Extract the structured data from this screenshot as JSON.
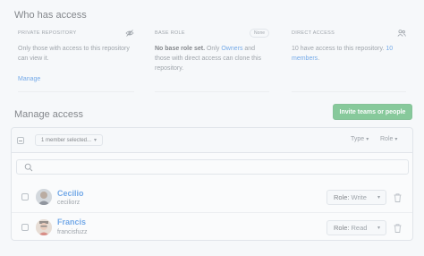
{
  "who_has_access": {
    "title": "Who has access",
    "private_repo": {
      "label": "PRIVATE REPOSITORY",
      "text": "Only those with access to this repository can view it.",
      "link": "Manage",
      "icon": "eye-closed-icon"
    },
    "base_role": {
      "label": "BASE ROLE",
      "badge": "None",
      "bold": "No base role set.",
      "text_1": " Only ",
      "link": "Owners",
      "text_2": " and those with direct access can clone this repository."
    },
    "direct_access": {
      "label": "DIRECT ACCESS",
      "icon": "people-icon",
      "text_1": "10 have access to this repository. ",
      "link": "10 members",
      "text_2": "."
    }
  },
  "manage_access": {
    "title": "Manage access",
    "invite_label": "Invite teams or people",
    "selection_label": "1 member selected...",
    "filter_type": "Type",
    "filter_role": "Role",
    "search_placeholder": ""
  },
  "members": [
    {
      "name": "Cecilio",
      "handle": "ceciliorz",
      "role_prefix": "Role:",
      "role": "Write"
    },
    {
      "name": "Francis",
      "handle": "francisfuzz",
      "role_prefix": "Role:",
      "role": "Read"
    }
  ],
  "colors": {
    "accent": "#0969da",
    "primary_button": "#2da44e",
    "muted": "#57606a"
  }
}
